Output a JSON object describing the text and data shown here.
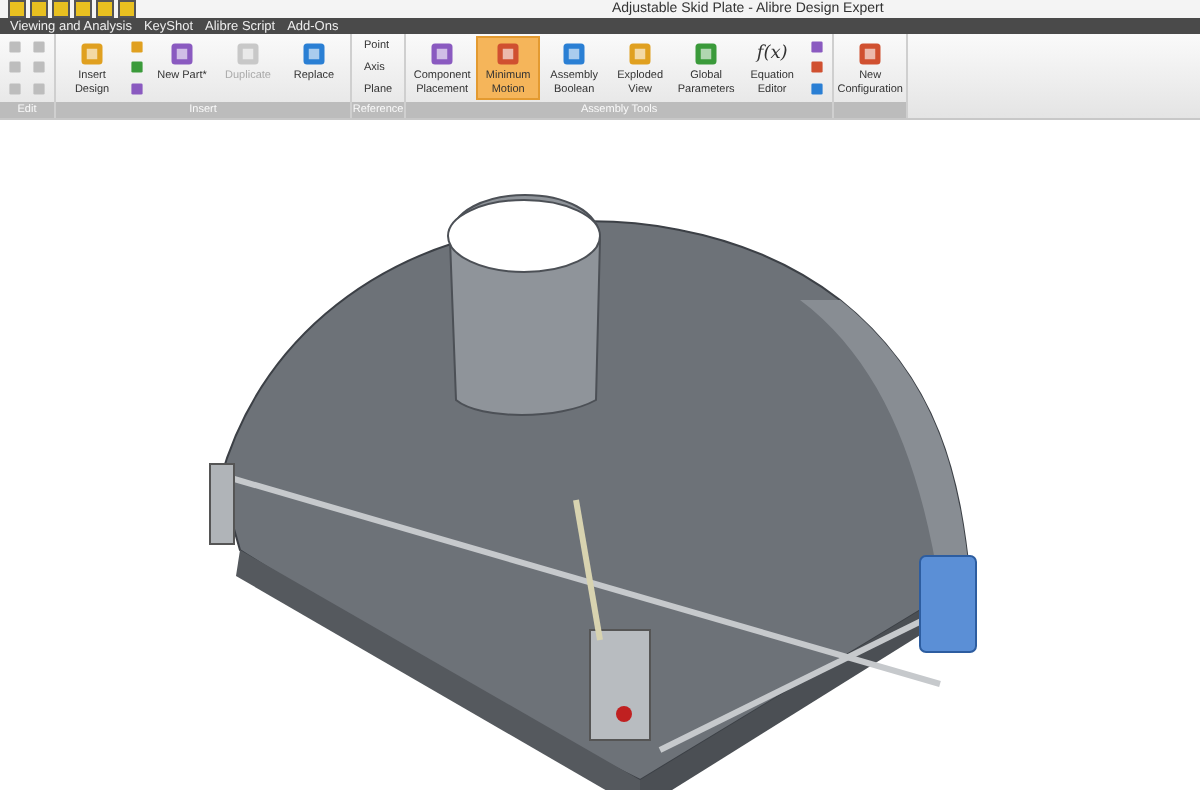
{
  "window": {
    "title": "Adjustable Skid Plate - Alibre Design Expert"
  },
  "menu": [
    {
      "label": "Viewing and Analysis"
    },
    {
      "label": "KeyShot"
    },
    {
      "label": "Alibre Script"
    },
    {
      "label": "Add-Ons"
    }
  ],
  "ribbon": [
    {
      "label": "Edit",
      "buttons": [
        {
          "kind": "small",
          "disabled": true
        },
        {
          "kind": "small",
          "disabled": true
        }
      ]
    },
    {
      "label": "Insert",
      "buttons": [
        {
          "kind": "large",
          "label": "Insert Design",
          "disabled": false,
          "selected": false
        },
        {
          "kind": "small",
          "disabled": false
        },
        {
          "kind": "large",
          "label": "New Part*",
          "disabled": false,
          "selected": false
        },
        {
          "kind": "large",
          "label": "Duplicate",
          "disabled": true,
          "selected": false
        },
        {
          "kind": "large",
          "label": "Replace",
          "disabled": false,
          "selected": false
        }
      ]
    },
    {
      "label": "Reference",
      "buttons": [
        {
          "kind": "list",
          "items": [
            {
              "label": "Point"
            },
            {
              "label": "Axis"
            },
            {
              "label": "Plane"
            }
          ]
        }
      ]
    },
    {
      "label": "Assembly Tools",
      "buttons": [
        {
          "kind": "large",
          "label": "Component Placement",
          "disabled": false,
          "selected": false
        },
        {
          "kind": "large",
          "label": "Minimum Motion",
          "disabled": false,
          "selected": true
        },
        {
          "kind": "large",
          "label": "Assembly Boolean",
          "disabled": false,
          "selected": false
        },
        {
          "kind": "large",
          "label": "Exploded View",
          "disabled": false,
          "selected": false
        },
        {
          "kind": "large",
          "label": "Global Parameters",
          "disabled": false,
          "selected": false
        },
        {
          "kind": "large",
          "label": "Equation Editor",
          "glyph": "f(x)",
          "disabled": false,
          "selected": false
        },
        {
          "kind": "small",
          "disabled": false
        }
      ]
    },
    {
      "buttons": [
        {
          "kind": "large",
          "label": "New Configuration",
          "disabled": false,
          "selected": false
        }
      ]
    }
  ]
}
